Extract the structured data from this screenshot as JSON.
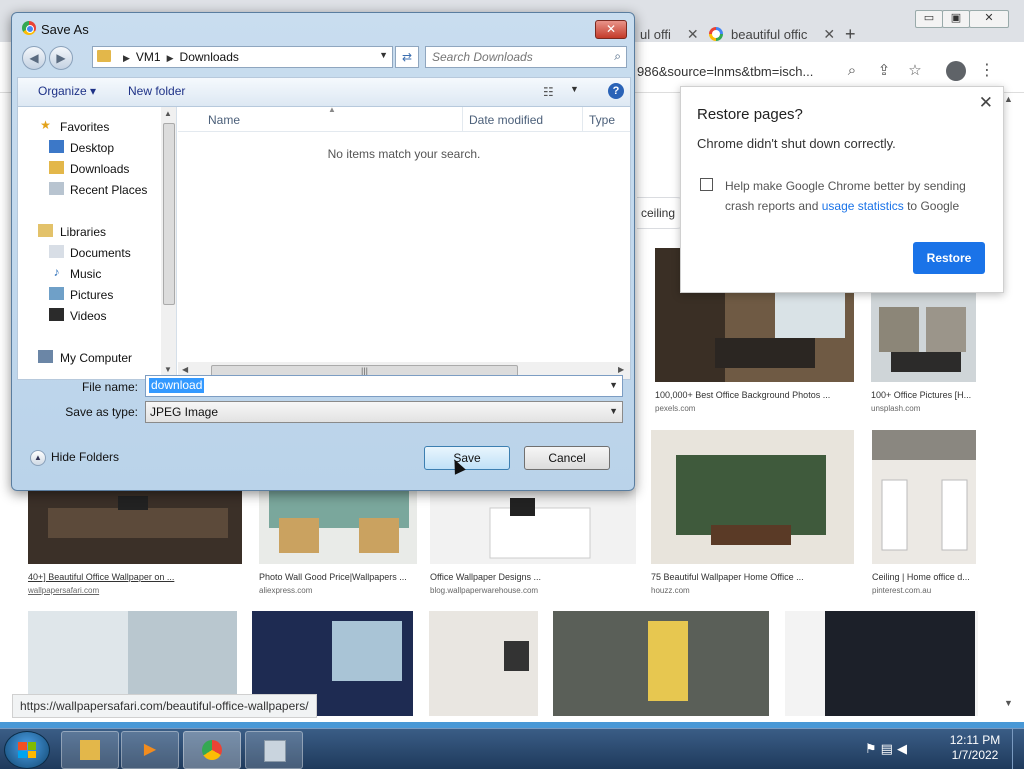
{
  "chrome": {
    "tabs": [
      {
        "label": "ul offi"
      },
      {
        "label": "beautiful offic"
      }
    ],
    "tab_close": "✕",
    "new_tab": "+",
    "url_fragment": "986&source=lnms&tbm=isch...",
    "window_buttons": {
      "minimize": "▭",
      "maximize": "▣",
      "close": "✕"
    }
  },
  "search_chip": {
    "label": "ceiling"
  },
  "results": [
    {
      "caption": "100,000+ Best Office Background Photos ...",
      "source": "pexels.com"
    },
    {
      "caption": "100+ Office Pictures [H...",
      "source": "unsplash.com"
    },
    {
      "caption": "40+] Beautiful Office Wallpaper on ...",
      "source": "wallpapersafari.com"
    },
    {
      "caption": "Photo Wall Good Price|Wallpapers ...",
      "source": "aliexpress.com"
    },
    {
      "caption": "Office Wallpaper Designs ...",
      "source": "blog.wallpaperwarehouse.com"
    },
    {
      "caption": "75 Beautiful Wallpaper Home Office ...",
      "source": "houzz.com"
    },
    {
      "caption": "Ceiling | Home office d...",
      "source": "pinterest.com.au"
    }
  ],
  "status_bar": {
    "url": "https://wallpapersafari.com/beautiful-office-wallpapers/"
  },
  "restore_popup": {
    "title": "Restore pages?",
    "message": "Chrome didn't shut down correctly.",
    "help_text_1": "Help make Google Chrome better by sending crash reports and ",
    "help_link": "usage statistics",
    "help_text_2": " to Google",
    "restore_label": "Restore",
    "close": "✕"
  },
  "dialog": {
    "title": "Save As",
    "close": "✕",
    "breadcrumb": [
      "VM1",
      "Downloads"
    ],
    "search_placeholder": "Search Downloads",
    "toolbar": {
      "organize": "Organize ▾",
      "new_folder": "New folder",
      "help": "?"
    },
    "nav": {
      "favorites": "Favorites",
      "desktop": "Desktop",
      "downloads": "Downloads",
      "recent_places": "Recent Places",
      "libraries": "Libraries",
      "documents": "Documents",
      "music": "Music",
      "pictures": "Pictures",
      "videos": "Videos",
      "my_computer": "My Computer"
    },
    "columns": {
      "name": "Name",
      "date_modified": "Date modified",
      "type": "Type"
    },
    "empty_message": "No items match your search.",
    "file_name_label": "File name:",
    "file_name_value": "download",
    "save_as_type_label": "Save as type:",
    "save_as_type_value": "JPEG Image",
    "hide_folders": "Hide Folders",
    "save_label": "Save",
    "cancel_label": "Cancel"
  },
  "taskbar": {
    "clock_time": "12:11 PM",
    "clock_date": "1/7/2022"
  },
  "colors": {
    "accent": "#1a73e8",
    "selection": "#3399ff"
  }
}
